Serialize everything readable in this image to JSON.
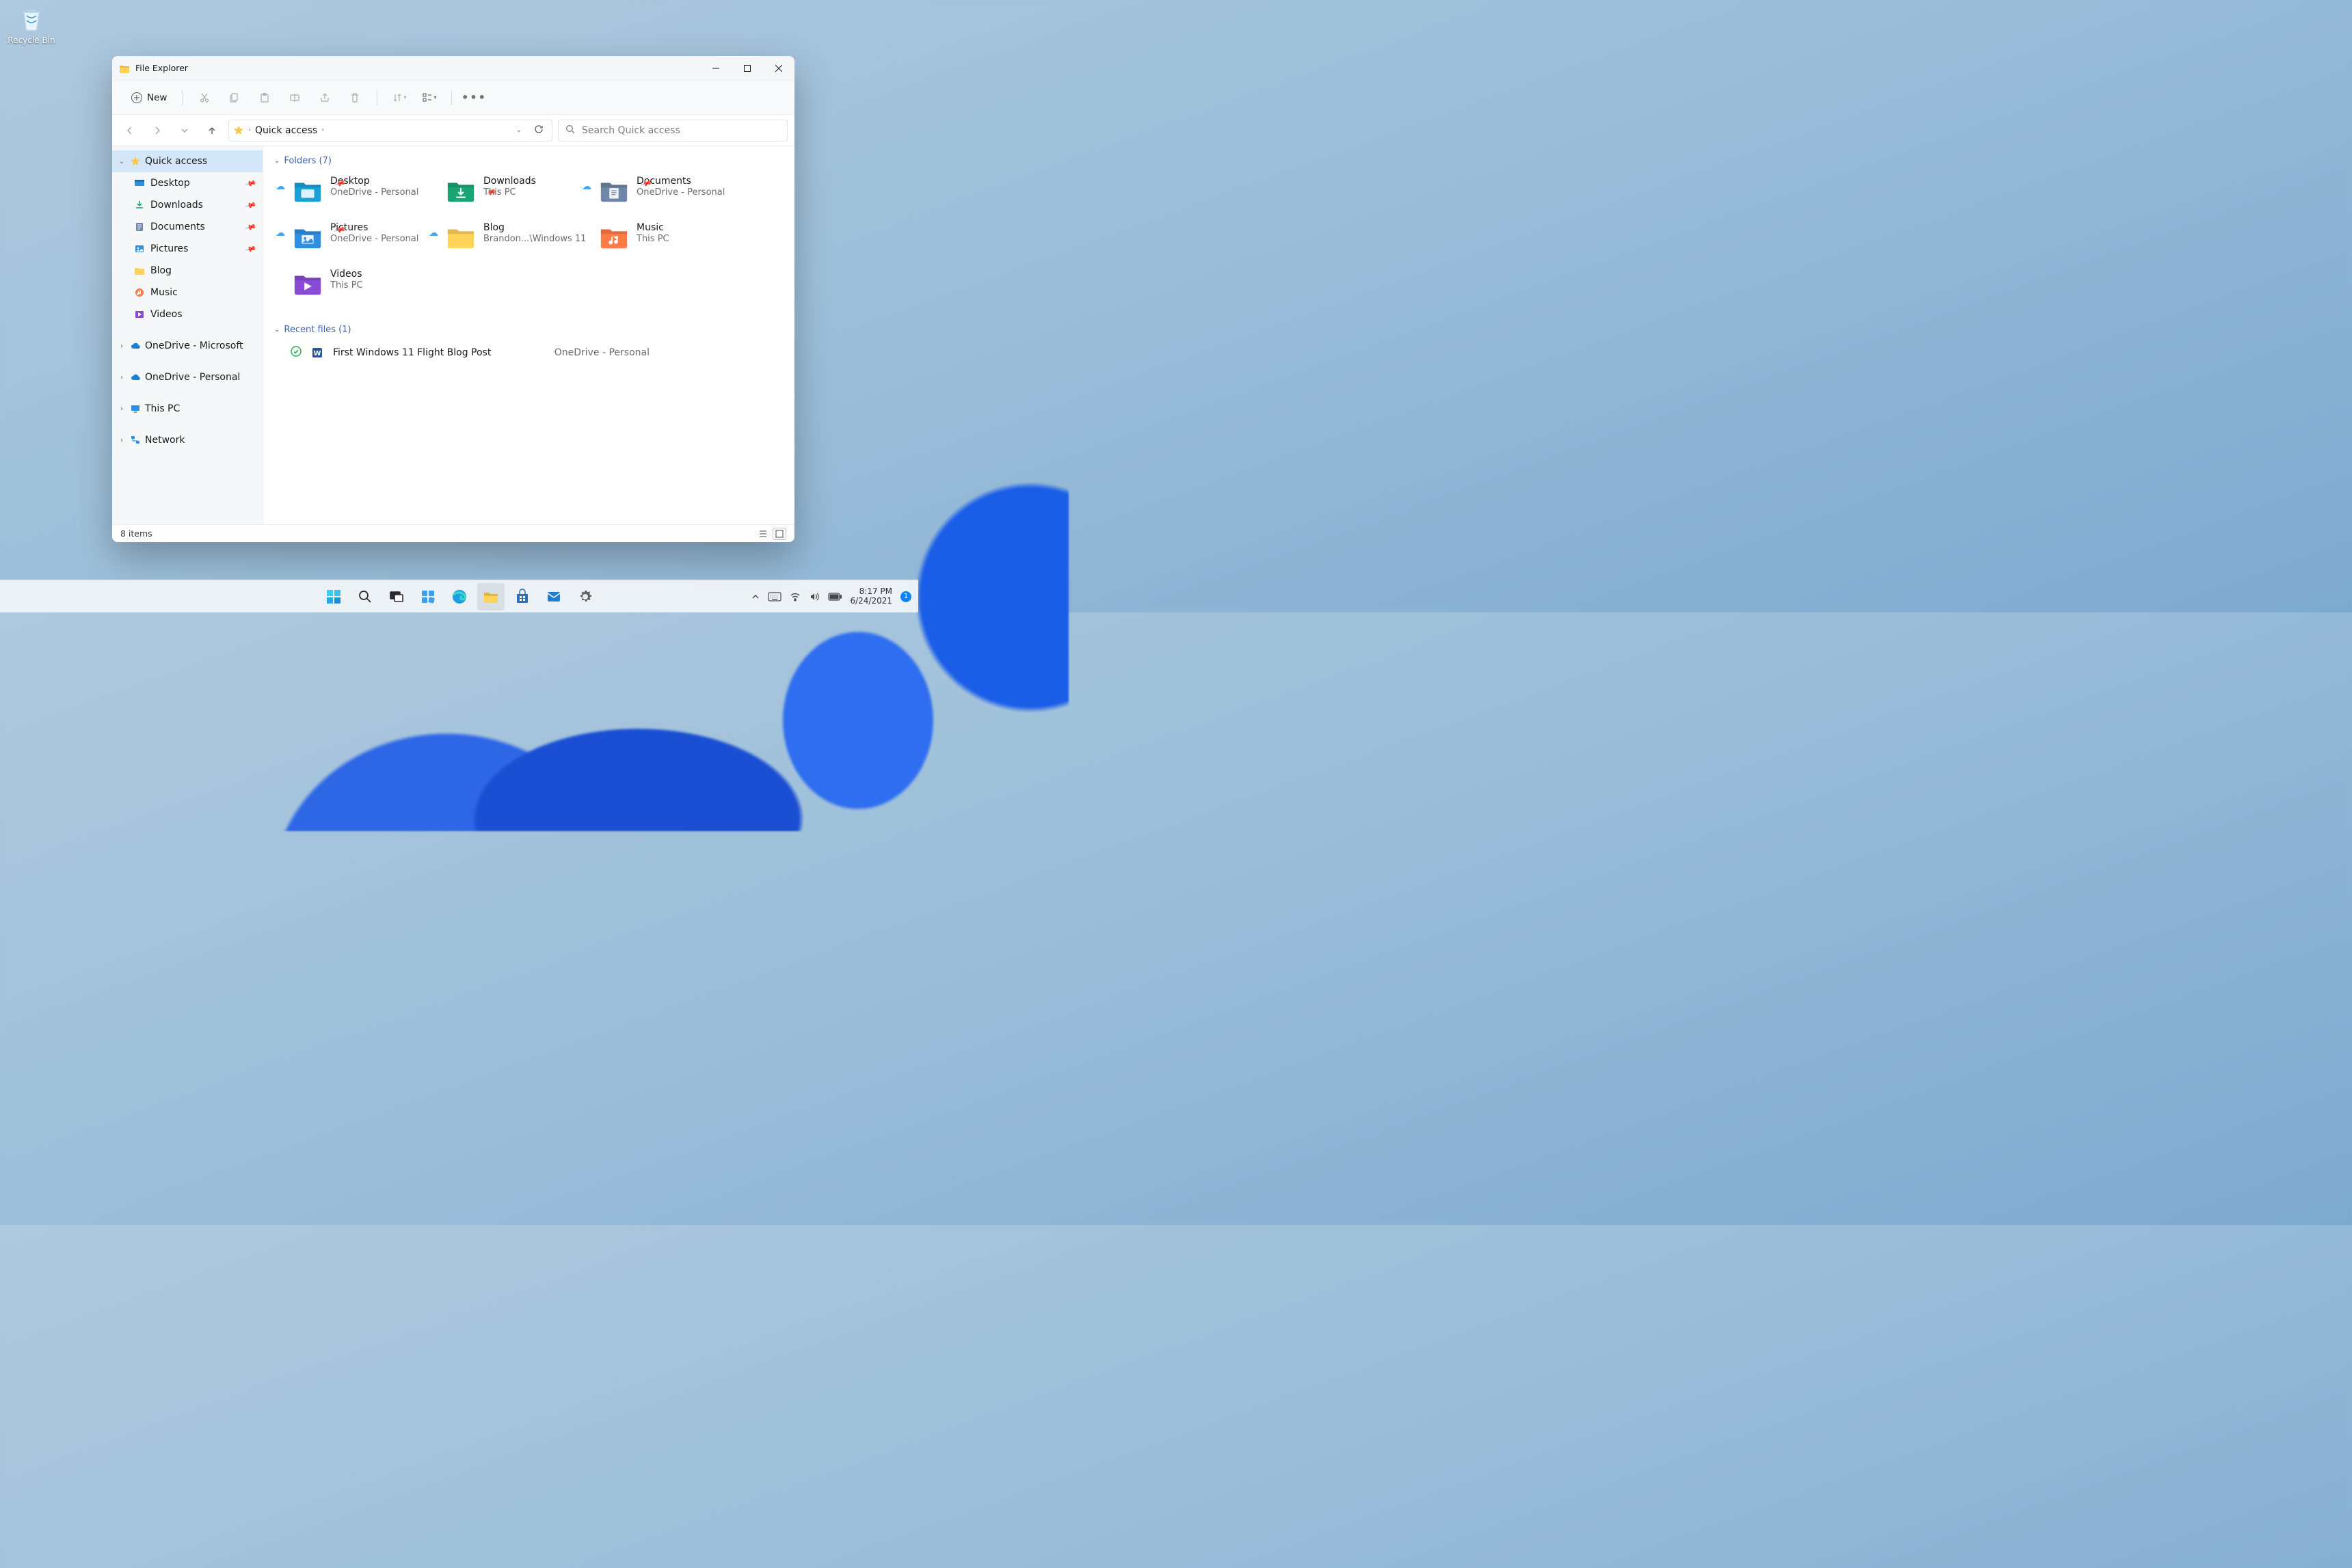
{
  "desktop": {
    "recycle_bin": "Recycle Bin"
  },
  "window": {
    "title": "File Explorer",
    "toolbar": {
      "new": "New"
    },
    "breadcrumb": {
      "current": "Quick access"
    },
    "search": {
      "placeholder": "Search Quick access"
    },
    "status": {
      "items": "8 items"
    }
  },
  "sidebar": {
    "quick_access": "Quick access",
    "items": [
      {
        "label": "Desktop",
        "pinned": true
      },
      {
        "label": "Downloads",
        "pinned": true
      },
      {
        "label": "Documents",
        "pinned": true
      },
      {
        "label": "Pictures",
        "pinned": true
      },
      {
        "label": "Blog",
        "pinned": false
      },
      {
        "label": "Music",
        "pinned": false
      },
      {
        "label": "Videos",
        "pinned": false
      }
    ],
    "roots": [
      {
        "label": "OneDrive - Microsoft"
      },
      {
        "label": "OneDrive - Personal"
      },
      {
        "label": "This PC"
      },
      {
        "label": "Network"
      }
    ]
  },
  "sections": {
    "folders": {
      "title": "Folders (7)"
    },
    "recent": {
      "title": "Recent files (1)"
    }
  },
  "folders": [
    {
      "name": "Desktop",
      "location": "OneDrive - Personal",
      "cloud": true,
      "pinned": true,
      "tint": "#1aa0d8"
    },
    {
      "name": "Downloads",
      "location": "This PC",
      "cloud": false,
      "pinned": true,
      "tint": "#17a673"
    },
    {
      "name": "Documents",
      "location": "OneDrive - Personal",
      "cloud": true,
      "pinned": true,
      "tint": "#6f86a8"
    },
    {
      "name": "Pictures",
      "location": "OneDrive - Personal",
      "cloud": true,
      "pinned": true,
      "tint": "#2f8fe0"
    },
    {
      "name": "Blog",
      "location": "Brandon...\\Windows 11",
      "cloud": true,
      "pinned": false,
      "tint": "#ffd25a"
    },
    {
      "name": "Music",
      "location": "This PC",
      "cloud": false,
      "pinned": false,
      "tint": "#ff7b47"
    },
    {
      "name": "Videos",
      "location": "This PC",
      "cloud": false,
      "pinned": false,
      "tint": "#8a4bd6"
    }
  ],
  "recent_files": [
    {
      "name": "First Windows 11 Flight Blog Post",
      "location": "OneDrive - Personal"
    }
  ],
  "taskbar": {
    "time": "8:17 PM",
    "date": "6/24/2021",
    "notif_count": "1"
  }
}
